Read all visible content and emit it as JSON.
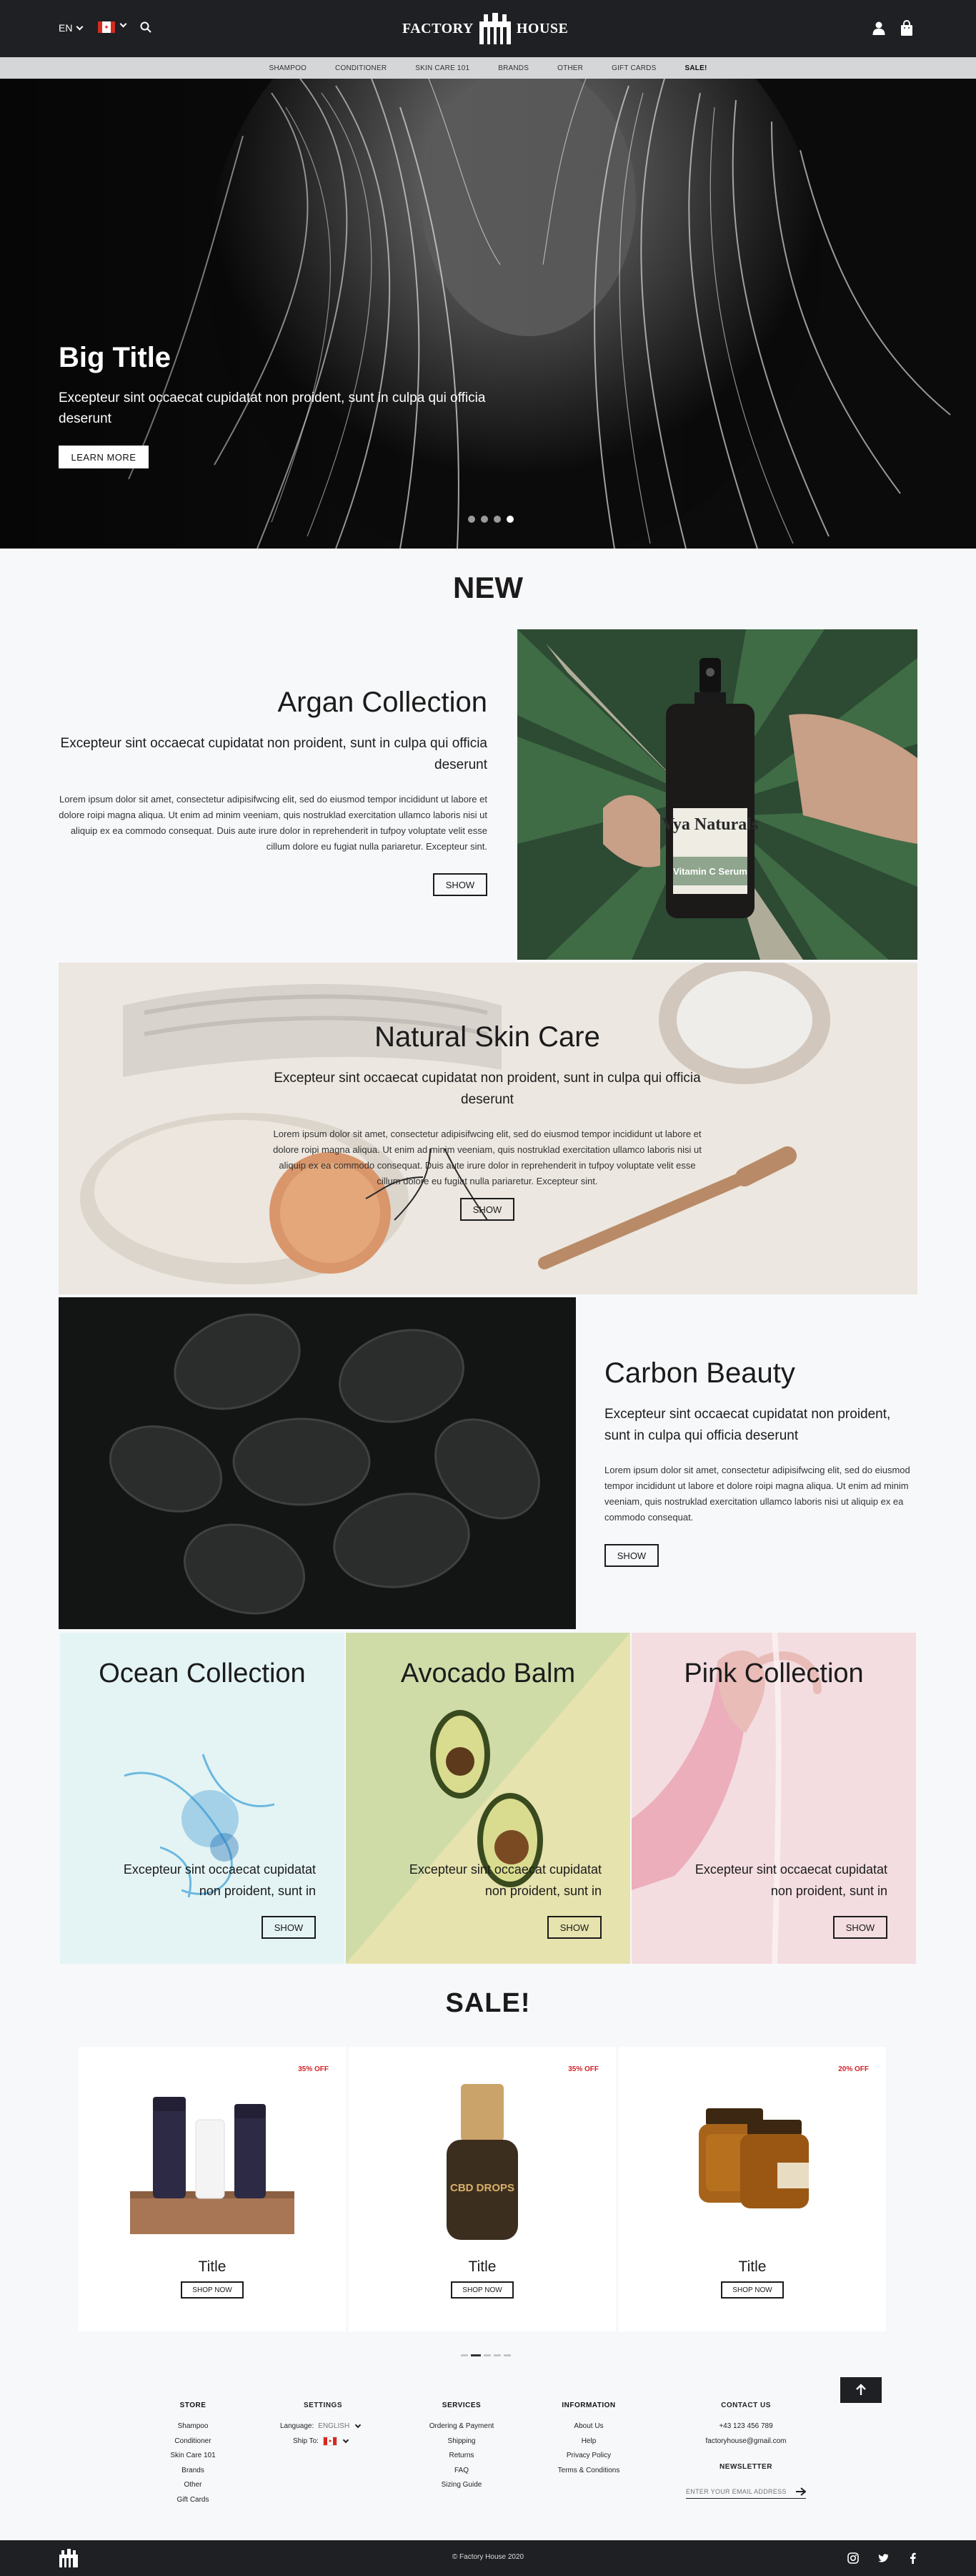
{
  "header": {
    "language": "EN",
    "logo_left": "FACTORY",
    "logo_right": "HOUSE"
  },
  "nav": {
    "items": [
      "SHAMPOO",
      "CONDITIONER",
      "SKIN CARE 101",
      "BRANDS",
      "OTHER",
      "GIFT CARDS",
      "SALE!"
    ]
  },
  "hero": {
    "title": "Big Title",
    "subtitle": "Excepteur sint occaecat cupidatat non proident, sunt in culpa qui officia deserunt",
    "button": "LEARN MORE",
    "slides": 4,
    "active_slide": 4
  },
  "new_section": {
    "title": "NEW",
    "argan": {
      "title": "Argan Collection",
      "lead": "Excepteur sint occaecat cupidatat non proident, sunt in culpa qui officia deserunt",
      "body": "Lorem ipsum dolor sit amet, consectetur adipisifwcing elit, sed do eiusmod tempor incididunt ut labore et dolore roipi magna aliqua. Ut enim ad minim veeniam, quis nostruklad exercitation ullamco laboris nisi ut aliquip ex ea commodo consequat. Duis aute irure dolor in reprehenderit in tufpoy voluptate velit esse cillum dolore eu fugiat nulla pariaretur. Excepteur sint.",
      "button": "SHOW",
      "bottle_brand": "Vya Naturals",
      "bottle_label": "Vitamin C Serum"
    },
    "natural": {
      "title": "Natural Skin Care",
      "lead": "Excepteur sint occaecat cupidatat non proident, sunt in culpa qui officia deserunt",
      "body": "Lorem ipsum dolor sit amet, consectetur adipisifwcing elit, sed do eiusmod tempor incididunt ut labore et dolore roipi magna aliqua. Ut enim ad minim veeniam, quis nostruklad exercitation ullamco laboris nisi ut aliquip ex ea commodo consequat. Duis aute irure dolor in reprehenderit in tufpoy voluptate velit esse cillum dolore eu fugiat nulla pariaretur. Excepteur sint.",
      "button": "SHOW"
    },
    "carbon": {
      "title": "Carbon Beauty",
      "lead": "Excepteur sint occaecat cupidatat non proident, sunt in culpa qui officia deserunt",
      "body": "Lorem ipsum dolor sit amet, consectetur adipisifwcing elit, sed do eiusmod tempor incididunt ut labore et dolore roipi magna aliqua. Ut enim ad minim veeniam, quis nostruklad exercitation ullamco laboris nisi ut aliquip ex ea commodo consequat.",
      "button": "SHOW"
    }
  },
  "collections": [
    {
      "title": "Ocean Collection",
      "subtitle": "Excepteur sint occaecat cupidatat non proident, sunt in",
      "button": "SHOW",
      "color": "#dff1f1"
    },
    {
      "title": "Avocado Balm",
      "subtitle": "Excepteur sint occaecat cupidatat non proident, sunt in",
      "button": "SHOW",
      "color": "#dde6b8"
    },
    {
      "title": "Pink Collection",
      "subtitle": "Excepteur sint occaecat cupidatat non proident, sunt in",
      "button": "SHOW",
      "color": "#f1d6dc"
    }
  ],
  "sale": {
    "title": "SALE!",
    "products": [
      {
        "discount": "35% OFF",
        "title": "Title",
        "button": "SHOP NOW"
      },
      {
        "discount": "35% OFF",
        "title": "Title",
        "button": "SHOP NOW",
        "label": "CBD DROPS"
      },
      {
        "discount": "20% OFF",
        "title": "Title",
        "button": "SHOP NOW"
      }
    ],
    "pages": 5,
    "active_page": 2
  },
  "footer": {
    "store": {
      "heading": "STORE",
      "links": [
        "Shampoo",
        "Conditioner",
        "Skin Care 101",
        "Brands",
        "Other",
        "Gift Cards"
      ]
    },
    "settings": {
      "heading": "SETTINGS",
      "language_label": "Language:",
      "language_value": "ENGLISH",
      "ship_label": "Ship To:"
    },
    "services": {
      "heading": "SERVICES",
      "links": [
        "Ordering & Payment",
        "Shipping",
        "Returns",
        "FAQ",
        "Sizing Guide"
      ]
    },
    "information": {
      "heading": "INFORMATION",
      "links": [
        "About Us",
        "Help",
        "Privacy Policy",
        "Terms & Conditions"
      ]
    },
    "contact": {
      "heading": "CONTACT US",
      "phone": "+43 123 456 789",
      "email": "factoryhouse@gmail.com",
      "newsletter": "NEWSLETTER",
      "email_placeholder": "ENTER YOUR EMAIL ADDRESS"
    },
    "copyright": "© Factory House 2020"
  },
  "colors": {
    "header_bg": "#1f2023",
    "nav_bg": "#d5d6d8",
    "page_bg": "#f7f8fa",
    "sale_red": "#d4222a"
  }
}
